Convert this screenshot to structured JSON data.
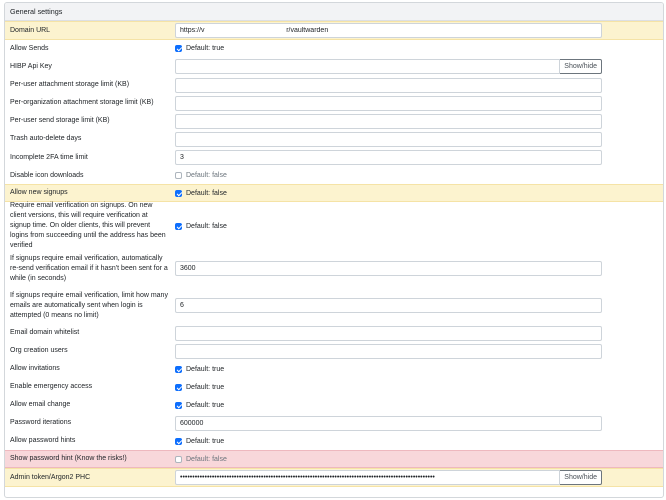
{
  "header": {
    "title": "General settings"
  },
  "buttons": {
    "show_hide": "Show/hide"
  },
  "settings": [
    {
      "label": "Domain URL",
      "type": "text",
      "value": "https://v                                          r/vaultwarden",
      "highlight": "yellow",
      "height": 19
    },
    {
      "label": "Allow Sends",
      "type": "check",
      "checked": true,
      "note": "Default: true",
      "height": 17
    },
    {
      "label": "HIBP Api Key",
      "type": "text-btn",
      "value": "",
      "height": 19
    },
    {
      "label": "Per-user attachment storage limit (KB)",
      "type": "text",
      "value": "",
      "height": 18
    },
    {
      "label": "Per-organization attachment storage limit (KB)",
      "type": "text",
      "value": "",
      "height": 18
    },
    {
      "label": "Per-user send storage limit (KB)",
      "type": "text",
      "value": "",
      "height": 18
    },
    {
      "label": "Trash auto-delete days",
      "type": "text",
      "value": "",
      "height": 18
    },
    {
      "label": "Incomplete 2FA time limit",
      "type": "text",
      "value": "3",
      "height": 19
    },
    {
      "label": "Disable icon downloads",
      "type": "check",
      "checked": false,
      "note": "Default: false",
      "height": 17
    },
    {
      "label": "Allow new signups",
      "type": "check",
      "checked": true,
      "note": "Default: false",
      "highlight": "yellow",
      "height": 18
    },
    {
      "label": "Require email verification on signups. On new client versions, this will require verification at signup time. On older clients, this will prevent logins from succeeding until the address has been verified",
      "type": "check",
      "checked": true,
      "note": "Default: false",
      "height": 48
    },
    {
      "label": "If signups require email verification, automatically re-send verification email if it hasn't been sent for a while (in seconds)",
      "type": "text",
      "value": "3600",
      "height": 37
    },
    {
      "label": "If signups require email verification, limit how many emails are automatically sent when login is attempted (0 means no limit)",
      "type": "text",
      "value": "6",
      "height": 37
    },
    {
      "label": "Email domain whitelist",
      "type": "text",
      "value": "",
      "height": 18
    },
    {
      "label": "Org creation users",
      "type": "text",
      "value": "",
      "height": 18
    },
    {
      "label": "Allow invitations",
      "type": "check",
      "checked": true,
      "note": "Default: true",
      "height": 18
    },
    {
      "label": "Enable emergency access",
      "type": "check",
      "checked": true,
      "note": "Default: true",
      "height": 18
    },
    {
      "label": "Allow email change",
      "type": "check",
      "checked": true,
      "note": "Default: true",
      "height": 18
    },
    {
      "label": "Password iterations",
      "type": "text",
      "value": "600000",
      "height": 18
    },
    {
      "label": "Allow password hints",
      "type": "check",
      "checked": true,
      "note": "Default: true",
      "height": 18
    },
    {
      "label": "Show password hint (Know the risks!)",
      "type": "check",
      "checked": false,
      "note": "Default: false",
      "highlight": "red",
      "height": 18
    },
    {
      "label": "Admin token/Argon2 PHC",
      "type": "password-btn",
      "value": "••••••••••••••••••••••••••••••••••••••••••••••••••••••••••••••••••••••••••••••••••••••••••••••••••••••••",
      "highlight": "yellow",
      "height": 19
    }
  ]
}
